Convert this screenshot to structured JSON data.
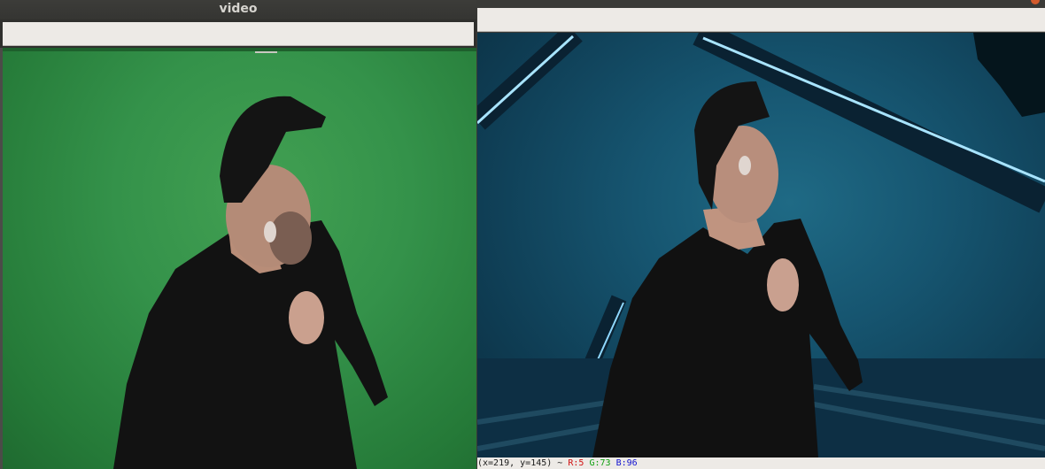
{
  "left_window": {
    "title": "video",
    "frame_description": "source-green-screen-frame"
  },
  "right_window": {
    "frame_description": "composited-background-frame",
    "status": {
      "coords": "(x=219, y=145) ~",
      "r": "R:5",
      "g": "G:73",
      "b": "B:96"
    }
  },
  "colors": {
    "green_screen": "#3a9a4c",
    "composite_bg": "#165570",
    "neon_line": "#8fd8ff",
    "toolbar": "#edeae6",
    "titlebar": "#3a3a37"
  }
}
